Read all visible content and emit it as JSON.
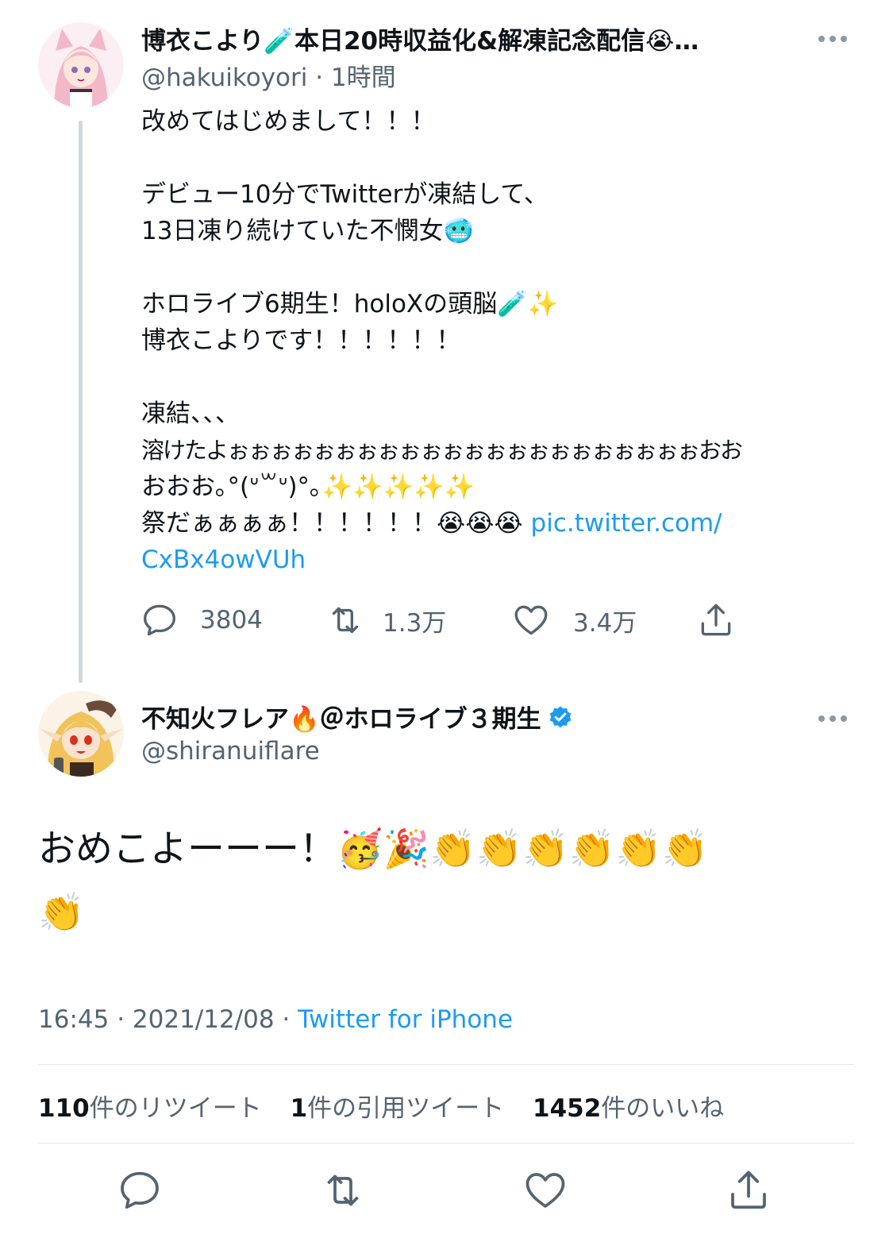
{
  "tweet1": {
    "author_name": "博衣こより🧪本日20時収益化&解凍記念配信😭…",
    "handle": "@hakuikoyori",
    "time": " · 1時間",
    "lines": [
      "改めてはじめまして！！！",
      "",
      "デビュー10分でTwitterが凍結して、",
      "13日凍り続けていた不憫女🥶",
      "",
      "ホロライブ6期生！holoXの頭脳🧪✨",
      "博衣こよりです！！！！！！",
      "",
      "凍結、、、",
      "溶けたよぉぉぉぉぉぉぉぉぉぉぉぉぉぉぉぉぉぉぉぉぉぉおお",
      "おおお｡°(ᐡ꒳ᐡ)°｡✨✨✨✨✨"
    ],
    "last_line_text": "祭だぁぁぁぁ！！！！！！😭😭😭 ",
    "link_part1": "pic.twitter.com/",
    "link_part2": "CxBx4owVUh",
    "replies": "3804",
    "retweets": "1.3万",
    "likes": "3.4万",
    "icons": [
      "reply-icon",
      "retweet-icon",
      "like-icon",
      "share-icon"
    ]
  },
  "tweet2": {
    "author_name": "不知火フレア🔥＠ホロライブ３期生",
    "handle": "@shiranuiflare",
    "text_line1": "おめこよーーー！🥳🎉👏👏👏👏👏👏",
    "text_line2": "👏",
    "timestamp": "16:45 · 2021/12/08 · ",
    "source": "Twitter for iPhone",
    "retweet_count": "110",
    "retweet_label": "件のリツイート",
    "quote_count": "1",
    "quote_label": "件の引用ツイート",
    "like_count": "1452",
    "like_label": "件のいいね"
  },
  "colors": {
    "link": "#1d9bf0",
    "verified": "#1d9bf0",
    "secondary_text": "#536471",
    "thread_line": "#cfd9de"
  }
}
